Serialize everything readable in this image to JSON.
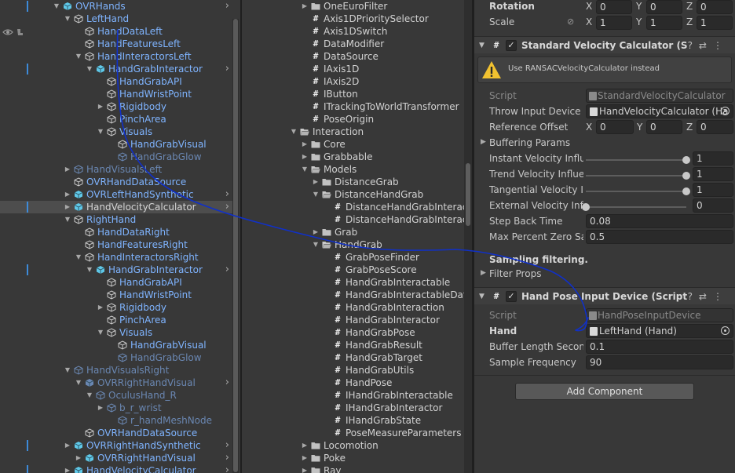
{
  "hierarchy": {
    "rows": [
      {
        "label": "OVRHands",
        "type": "prefab"
      },
      {
        "label": "LeftHand",
        "type": "go"
      },
      {
        "label": "HandDataLeft",
        "type": "go"
      },
      {
        "label": "HandFeaturesLeft",
        "type": "go"
      },
      {
        "label": "HandInteractorsLeft",
        "type": "go"
      },
      {
        "label": "HandGrabInteractor",
        "type": "prefab"
      },
      {
        "label": "HandGrabAPI",
        "type": "go"
      },
      {
        "label": "HandWristPoint",
        "type": "go"
      },
      {
        "label": "Rigidbody",
        "type": "go"
      },
      {
        "label": "PinchArea",
        "type": "go"
      },
      {
        "label": "Visuals",
        "type": "go"
      },
      {
        "label": "HandGrabVisual",
        "type": "go"
      },
      {
        "label": "HandGrabGlow",
        "type": "go"
      },
      {
        "label": "HandVisualsLeft",
        "type": "go"
      },
      {
        "label": "OVRHandDataSource",
        "type": "go"
      },
      {
        "label": "OVRLeftHandSynthetic",
        "type": "prefab"
      },
      {
        "label": "HandVelocityCalculator",
        "type": "prefab"
      },
      {
        "label": "RightHand",
        "type": "go"
      },
      {
        "label": "HandDataRight",
        "type": "go"
      },
      {
        "label": "HandFeaturesRight",
        "type": "go"
      },
      {
        "label": "HandInteractorsRight",
        "type": "go"
      },
      {
        "label": "HandGrabInteractor",
        "type": "prefab"
      },
      {
        "label": "HandGrabAPI",
        "type": "go"
      },
      {
        "label": "HandWristPoint",
        "type": "go"
      },
      {
        "label": "Rigidbody",
        "type": "go"
      },
      {
        "label": "PinchArea",
        "type": "go"
      },
      {
        "label": "Visuals",
        "type": "go"
      },
      {
        "label": "HandGrabVisual",
        "type": "go"
      },
      {
        "label": "HandGrabGlow",
        "type": "go"
      },
      {
        "label": "HandVisualsRight",
        "type": "go"
      },
      {
        "label": "OVRRightHandVisual",
        "type": "prefab"
      },
      {
        "label": "OculusHand_R",
        "type": "go"
      },
      {
        "label": "b_r_wrist",
        "type": "go"
      },
      {
        "label": "r_handMeshNode",
        "type": "go"
      },
      {
        "label": "OVRHandDataSource",
        "type": "go"
      },
      {
        "label": "OVRRightHandSynthetic",
        "type": "prefab"
      },
      {
        "label": "OVRRightHandVisual",
        "type": "prefab"
      },
      {
        "label": "HandVelocityCalculator",
        "type": "prefab"
      }
    ]
  },
  "project": {
    "rows": [
      {
        "label": "OneEuroFilter",
        "kind": "folder"
      },
      {
        "label": "Axis1DPrioritySelector",
        "kind": "script"
      },
      {
        "label": "Axis1DSwitch",
        "kind": "script"
      },
      {
        "label": "DataModifier",
        "kind": "script"
      },
      {
        "label": "DataSource",
        "kind": "script"
      },
      {
        "label": "IAxis1D",
        "kind": "script"
      },
      {
        "label": "IAxis2D",
        "kind": "script"
      },
      {
        "label": "IButton",
        "kind": "script"
      },
      {
        "label": "ITrackingToWorldTransformer",
        "kind": "script"
      },
      {
        "label": "PoseOrigin",
        "kind": "script"
      },
      {
        "label": "Interaction",
        "kind": "folder"
      },
      {
        "label": "Core",
        "kind": "folder"
      },
      {
        "label": "Grabbable",
        "kind": "folder"
      },
      {
        "label": "Models",
        "kind": "folder"
      },
      {
        "label": "DistanceGrab",
        "kind": "folder"
      },
      {
        "label": "DistanceHandGrab",
        "kind": "folder"
      },
      {
        "label": "DistanceHandGrabInteract",
        "kind": "script"
      },
      {
        "label": "DistanceHandGrabInteract",
        "kind": "script"
      },
      {
        "label": "Grab",
        "kind": "folder"
      },
      {
        "label": "HandGrab",
        "kind": "folder"
      },
      {
        "label": "GrabPoseFinder",
        "kind": "script"
      },
      {
        "label": "GrabPoseScore",
        "kind": "script"
      },
      {
        "label": "HandGrabInteractable",
        "kind": "script"
      },
      {
        "label": "HandGrabInteractableData",
        "kind": "script"
      },
      {
        "label": "HandGrabInteraction",
        "kind": "script"
      },
      {
        "label": "HandGrabInteractor",
        "kind": "script"
      },
      {
        "label": "HandGrabPose",
        "kind": "script"
      },
      {
        "label": "HandGrabResult",
        "kind": "script"
      },
      {
        "label": "HandGrabTarget",
        "kind": "script"
      },
      {
        "label": "HandGrabUtils",
        "kind": "script"
      },
      {
        "label": "HandPose",
        "kind": "script"
      },
      {
        "label": "IHandGrabInteractable",
        "kind": "script"
      },
      {
        "label": "IHandGrabInteractor",
        "kind": "script"
      },
      {
        "label": "IHandGrabState",
        "kind": "script"
      },
      {
        "label": "PoseMeasureParameters",
        "kind": "script"
      },
      {
        "label": "Locomotion",
        "kind": "folder"
      },
      {
        "label": "Poke",
        "kind": "folder"
      },
      {
        "label": "Ray",
        "kind": "folder"
      }
    ]
  },
  "inspector": {
    "transform": {
      "rotation_label": "Rotation",
      "rotation": {
        "x": "0",
        "y": "0",
        "z": "0"
      },
      "scale_label": "Scale",
      "scale": {
        "x": "1",
        "y": "1",
        "z": "1"
      },
      "axis_x": "X",
      "axis_y": "Y",
      "axis_z": "Z"
    },
    "velocity": {
      "title": "Standard Velocity Calculator (Scrip",
      "warning": "Use RANSACVelocityCalculator instead",
      "script_label": "Script",
      "script_value": "StandardVelocityCalculator",
      "throw_label": "Throw Input Device",
      "throw_value": "HandVelocityCalculator (Ha",
      "offset_label": "Reference Offset",
      "offset": {
        "x": "0",
        "y": "0",
        "z": "0"
      },
      "buffering_label": "Buffering Params",
      "instant_label": "Instant Velocity Influe",
      "instant_value": "1",
      "instant_fraction": 1.0,
      "trend_label": "Trend Velocity Influer",
      "trend_value": "1",
      "trend_fraction": 1.0,
      "tangential_label": "Tangential Velocity Ir",
      "tangential_value": "1",
      "tangential_fraction": 1.0,
      "external_label": "External Velocity Influ",
      "external_value": "0",
      "external_fraction": 0.0,
      "stepback_label": "Step Back Time",
      "stepback_value": "0.08",
      "maxzero_label": "Max Percent Zero Sa",
      "maxzero_value": "0.5",
      "sampling_label": "Sampling filtering.",
      "filter_label": "Filter Props"
    },
    "handpose": {
      "title": "Hand Pose Input Device (Script)",
      "script_label": "Script",
      "script_value": "HandPoseInputDevice",
      "hand_label": "Hand",
      "hand_value": "LeftHand (Hand)",
      "buffer_label": "Buffer Length Seconc",
      "buffer_value": "0.1",
      "freq_label": "Sample Frequency",
      "freq_value": "90"
    },
    "add_component": "Add Component"
  },
  "colors": {
    "blue_label": "#7fb4ff",
    "annotation": "#1030c8",
    "selected_row": "#4d4d4d"
  }
}
